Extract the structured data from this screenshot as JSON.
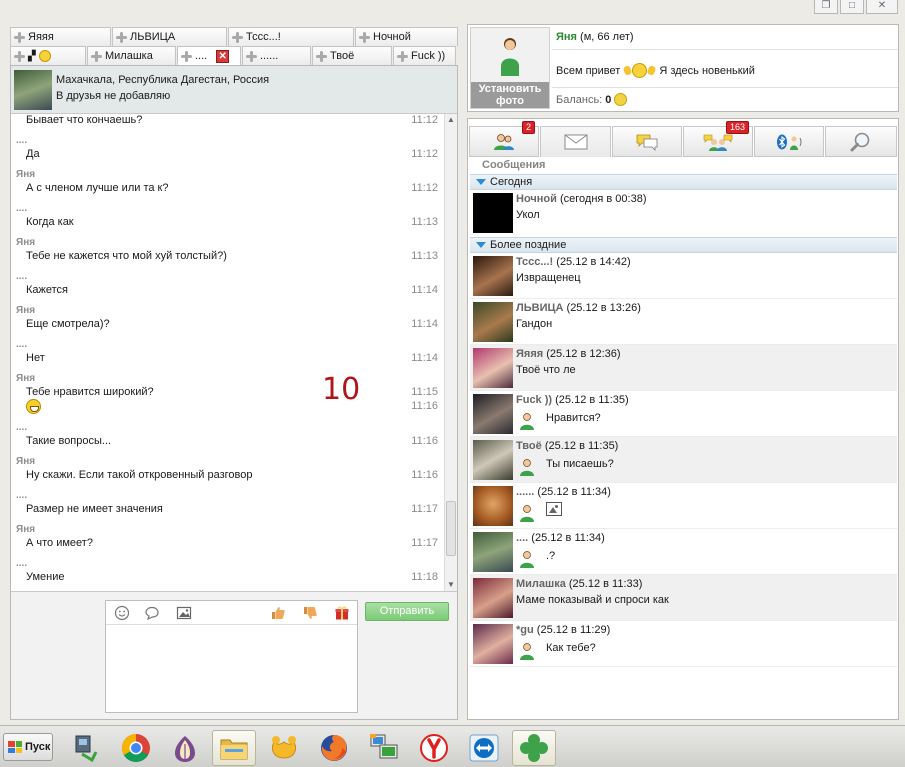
{
  "window": {
    "restore_glyph": "❐",
    "close_glyph": "✕"
  },
  "tabs_row1": [
    {
      "label": "Яяяя"
    },
    {
      "label": "ЛЬВИЦА"
    },
    {
      "label": "Тссс...!"
    },
    {
      "label": "Ночной"
    }
  ],
  "tabs_row2": [
    {
      "label": ""
    },
    {
      "label": "Милашка"
    },
    {
      "label": "....",
      "active": true
    },
    {
      "label": "......"
    },
    {
      "label": "Твоё"
    },
    {
      "label": "Fuck ))"
    }
  ],
  "chat_header": {
    "location": "Махачкала, Республика Дагестан, Россия",
    "note": "В друзья не добавляю"
  },
  "messages": [
    {
      "sender": "",
      "text": "Бывает что кончаешь?",
      "time": "11:12"
    },
    {
      "sender": "....",
      "text": "Да",
      "time": "11:12"
    },
    {
      "sender": "Яня",
      "text": "А с членом лучше или та к?",
      "time": "11:12"
    },
    {
      "sender": "....",
      "text": "Когда как",
      "time": "11:13"
    },
    {
      "sender": "Яня",
      "text": "Тебе не кажется что мой хуй толстый?)",
      "time": "11:13"
    },
    {
      "sender": "....",
      "text": "Кажется",
      "time": "11:14"
    },
    {
      "sender": "Яня",
      "text": "Еще смотрела)?",
      "time": "11:14"
    },
    {
      "sender": "....",
      "text": "Нет",
      "time": "11:14"
    },
    {
      "sender": "Яня",
      "text": "Тебе нравится широкий?",
      "time": "11:15",
      "time2": "11:16"
    },
    {
      "sender": "....",
      "text": "Такие вопросы...",
      "time": "11:16"
    },
    {
      "sender": "Яня",
      "text": "Ну скажи. Если такой откровенный разговор",
      "time": "11:16"
    },
    {
      "sender": "....",
      "text": "Размер не имеет значения",
      "time": "11:17"
    },
    {
      "sender": "Яня",
      "text": "А что имеет?",
      "time": "11:17"
    },
    {
      "sender": "....",
      "text": "Умение",
      "time": "11:18"
    }
  ],
  "overlay_number": "10",
  "compose": {
    "send_label": "Отправить"
  },
  "profile": {
    "name": "Яня",
    "meta": "(м, 66 лет)",
    "status_before": "Всем привет",
    "status_after": "Я здесь новенький",
    "balance_label": "Балансь:",
    "balance_value": "0",
    "photo_button": "Установить фото"
  },
  "side_tabs": [
    {
      "icon": "contacts-icon",
      "badge": "2"
    },
    {
      "icon": "envelope-icon",
      "badge": ""
    },
    {
      "icon": "chat-bubbles-icon",
      "badge": ""
    },
    {
      "icon": "group-chat-icon",
      "badge": "163"
    },
    {
      "icon": "bluetooth-icon",
      "badge": ""
    },
    {
      "icon": "search-icon",
      "badge": ""
    }
  ],
  "messages_section_label": "Сообщения",
  "groups": {
    "today": "Сегодня",
    "later": "Более поздние"
  },
  "conversations_today": [
    {
      "name": "Ночной",
      "when": "(сегодня в 00:38)",
      "preview": "Укол",
      "preview_type": "text",
      "avatar": "#000000"
    }
  ],
  "conversations_later": [
    {
      "name": "Тссс...!",
      "when": "(25.12 в 14:42)",
      "preview": "Извращенец",
      "preview_type": "text",
      "avatar": "#3a2418"
    },
    {
      "name": "ЛЬВИЦА",
      "when": "(25.12 в 13:26)",
      "preview": "Гандон",
      "preview_type": "text",
      "avatar": "#4a5a3a"
    },
    {
      "name": "Яяяя",
      "when": "(25.12 в 12:36)",
      "preview": "Твоё что ле",
      "preview_type": "text",
      "avatar": "#8a4a6a"
    },
    {
      "name": "Fuck ))",
      "when": "(25.12 в 11:35)",
      "preview": "Нравится?",
      "preview_type": "mine",
      "avatar": "#2a2a2e"
    },
    {
      "name": "Твоё",
      "when": "(25.12 в 11:35)",
      "preview": "Ты писаешь?",
      "preview_type": "mine",
      "avatar": "#4a4a3a"
    },
    {
      "name": "......",
      "when": "(25.12 в 11:34)",
      "preview": "",
      "preview_type": "image",
      "avatar": "#b26a2a"
    },
    {
      "name": "....",
      "when": "(25.12 в 11:34)",
      "preview": ".?",
      "preview_type": "mine",
      "avatar": "#3f5d3a"
    },
    {
      "name": "Милашка",
      "when": "(25.12 в 11:33)",
      "preview": "Маме показывай и спроси как",
      "preview_type": "text",
      "avatar": "#7a3a4a"
    },
    {
      "name": "*gu",
      "when": "(25.12 в 11:29)",
      "preview": "Как тебе?",
      "preview_type": "mine",
      "avatar": "#6a3a5a"
    }
  ],
  "taskbar": {
    "start_label": "Пуск",
    "apps": [
      "network-icon",
      "chrome-icon",
      "tor-icon",
      "explorer-icon",
      "mamba-icon",
      "firefox-icon",
      "remote-desktop-icon",
      "yandex-icon",
      "teamviewer-icon",
      "icq-icon"
    ]
  },
  "colors": {
    "accent_green": "#2e8a32",
    "badge_red": "#d8232a",
    "send_green": "#7bcb76"
  }
}
